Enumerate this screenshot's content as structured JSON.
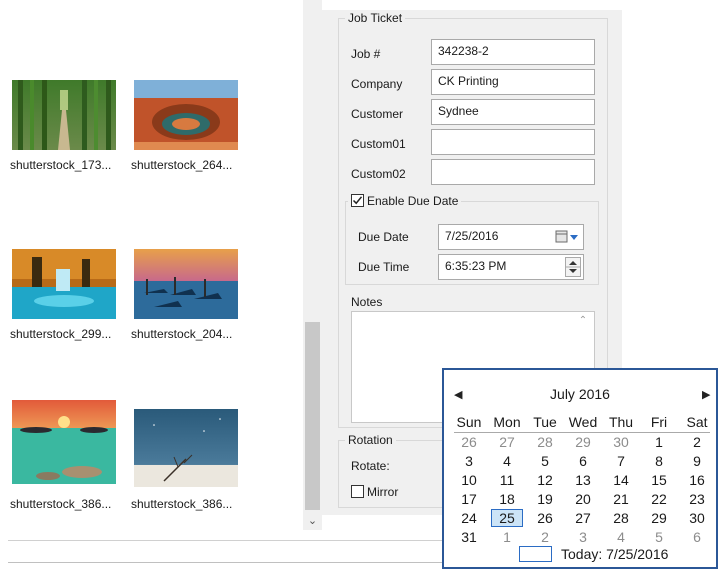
{
  "thumbnails": [
    {
      "caption": "shutterstock_173...",
      "icon": "bamboo-forest-photo"
    },
    {
      "caption": "shutterstock_264...",
      "icon": "canyon-bend-photo"
    },
    {
      "caption": "shutterstock_299...",
      "icon": "autumn-waterfall-photo"
    },
    {
      "caption": "shutterstock_204...",
      "icon": "gondolas-sunset-photo"
    },
    {
      "caption": "shutterstock_386...",
      "icon": "sunset-beach-photo"
    },
    {
      "caption": "shutterstock_386...",
      "icon": "snowy-branch-photo"
    }
  ],
  "job_ticket": {
    "legend": "Job Ticket",
    "job_label": "Job #",
    "job_value": "342238-2",
    "company_label": "Company",
    "company_value": "CK Printing",
    "customer_label": "Customer",
    "customer_value": "Sydnee",
    "custom01_label": "Custom01",
    "custom01_value": "",
    "custom02_label": "Custom02",
    "custom02_value": "",
    "enable_due_label": "Enable Due Date",
    "enable_due_checked": true,
    "due_date_label": "Due Date",
    "due_date_value": "7/25/2016",
    "due_time_label": "Due Time",
    "due_time_value": "6:35:23 PM",
    "notes_label": "Notes",
    "notes_value": ""
  },
  "rotation": {
    "legend": "Rotation",
    "rotate_label": "Rotate:",
    "mirror_label": "Mirror",
    "mirror_checked": false
  },
  "calendar": {
    "month_title": "July 2016",
    "prev_icon": "chevron-left-icon",
    "next_icon": "chevron-right-icon",
    "weekdays": [
      "Sun",
      "Mon",
      "Tue",
      "Wed",
      "Thu",
      "Fri",
      "Sat"
    ],
    "weeks": [
      [
        "26",
        "27",
        "28",
        "29",
        "30",
        "1",
        "2"
      ],
      [
        "3",
        "4",
        "5",
        "6",
        "7",
        "8",
        "9"
      ],
      [
        "10",
        "11",
        "12",
        "13",
        "14",
        "15",
        "16"
      ],
      [
        "17",
        "18",
        "19",
        "20",
        "21",
        "22",
        "23"
      ],
      [
        "24",
        "25",
        "26",
        "27",
        "28",
        "29",
        "30"
      ],
      [
        "31",
        "1",
        "2",
        "3",
        "4",
        "5",
        "6"
      ]
    ],
    "selected_day": "25",
    "today_label": "Today: 7/25/2016"
  },
  "colors": {
    "accent": "#2b6cc4",
    "calendar_border": "#2b5797",
    "panel_bg": "#f0f0f0",
    "grey_day": "#8c8c8c"
  }
}
